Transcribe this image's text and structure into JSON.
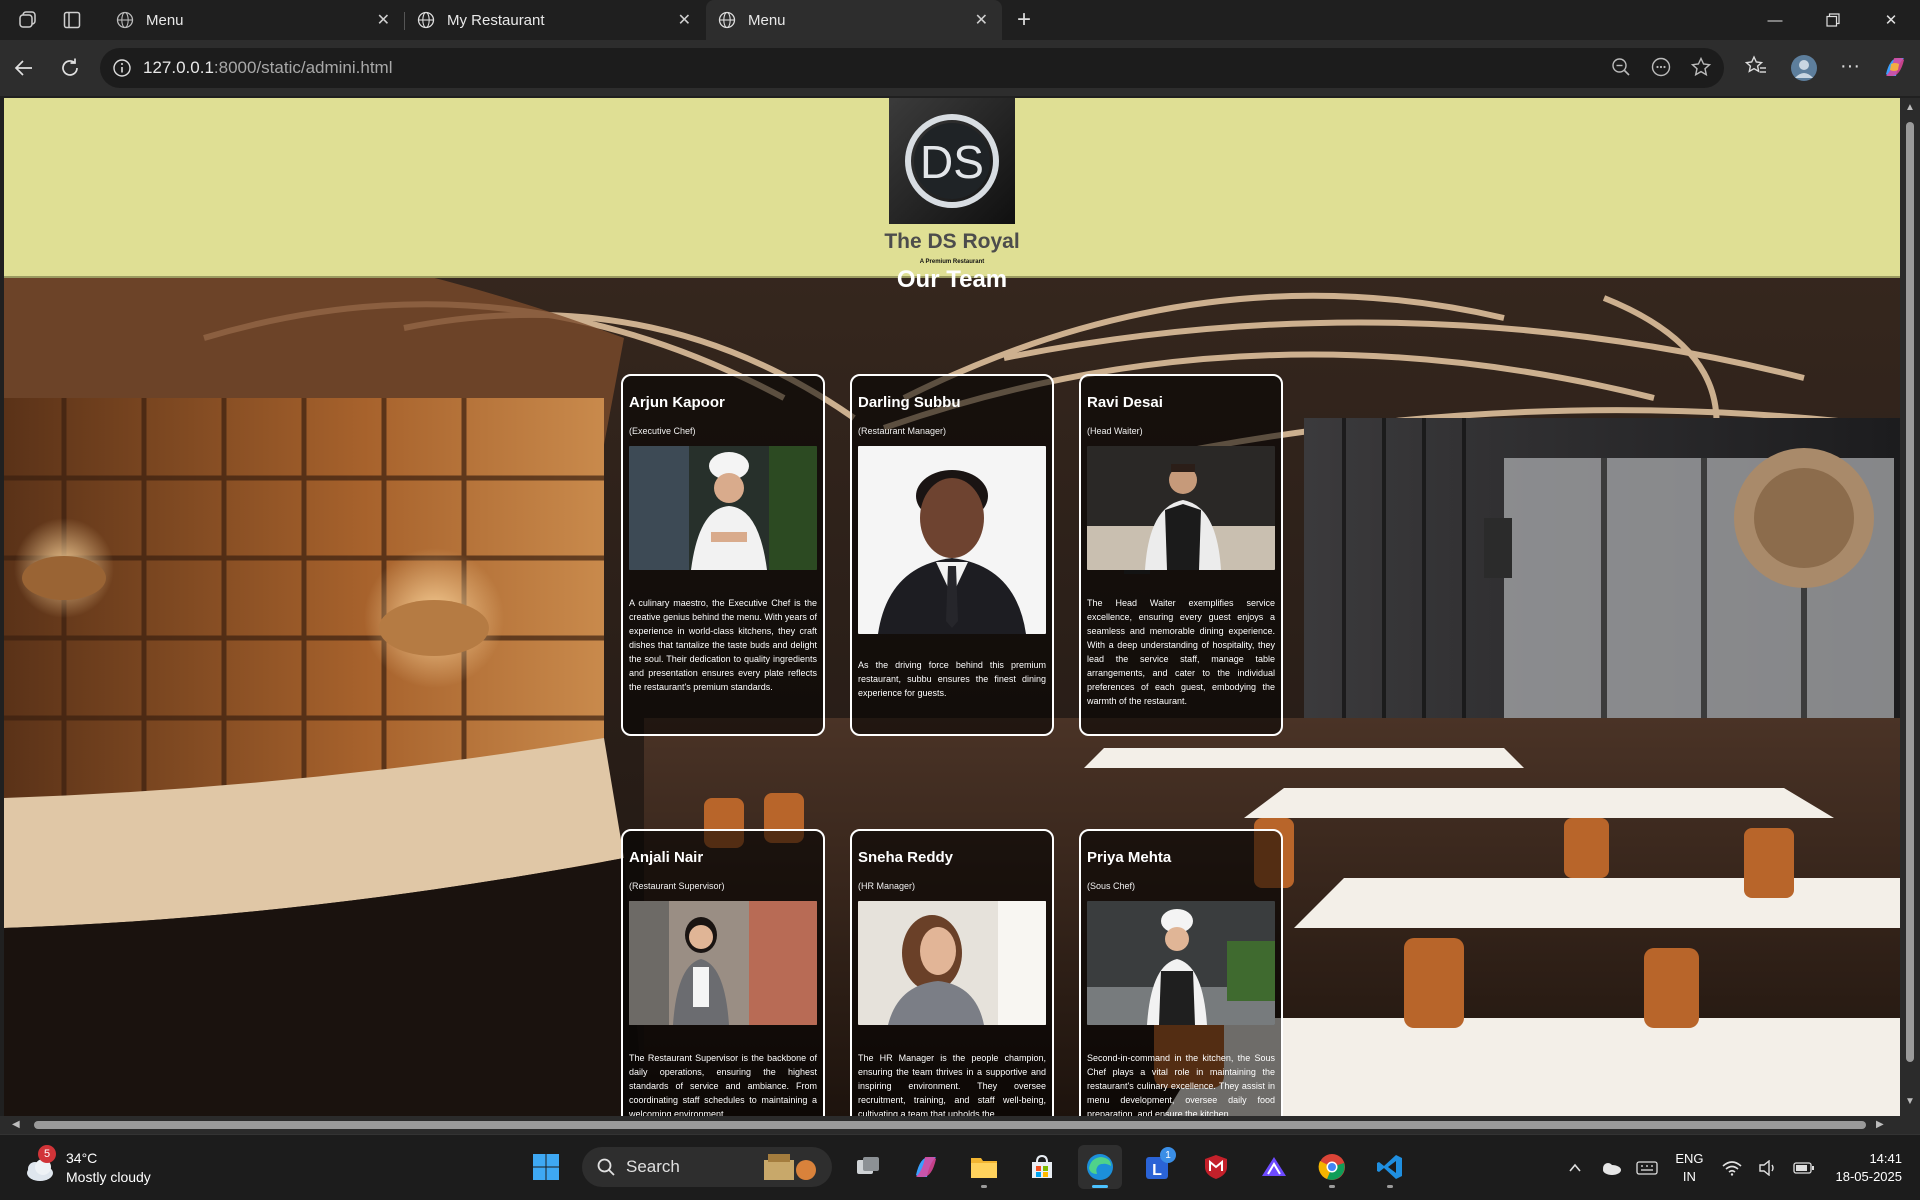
{
  "browser": {
    "tabs": [
      {
        "title": "Menu",
        "active": false
      },
      {
        "title": "My Restaurant",
        "active": false
      },
      {
        "title": "Menu",
        "active": true
      }
    ],
    "url_host": "127.0.0.1",
    "url_rest": ":8000/static/admini.html"
  },
  "site": {
    "logo_text": "DS",
    "brand_name": "The DS Royal",
    "brand_tagline": "A Premium Restaurant",
    "section_title": "Our Team"
  },
  "team": [
    {
      "name": "Arjun Kapoor",
      "role": "(Executive Chef)",
      "photo_icon": "chef-photo",
      "desc": "A culinary maestro, the Executive Chef is the creative genius behind the menu. With years of experience in world-class kitchens, they craft dishes that tantalize the taste buds and delight the soul. Their dedication to quality ingredients and presentation ensures every plate reflects the restaurant's premium standards."
    },
    {
      "name": "Darling Subbu",
      "role": "(Restaurant Manager)",
      "photo_icon": "manager-photo",
      "desc": "As the driving force behind this premium restaurant, subbu ensures the finest dining experience for guests."
    },
    {
      "name": "Ravi Desai",
      "role": "(Head Waiter)",
      "photo_icon": "waiter-photo",
      "desc": "The Head Waiter exemplifies service excellence, ensuring every guest enjoys a seamless and memorable dining experience. With a deep understanding of hospitality, they lead the service staff, manage table arrangements, and cater to the individual preferences of each guest, embodying the warmth of the restaurant."
    },
    {
      "name": "Anjali Nair",
      "role": "(Restaurant Supervisor)",
      "photo_icon": "supervisor-photo",
      "desc": "The Restaurant Supervisor is the backbone of daily operations, ensuring the highest standards of service and ambiance. From coordinating staff schedules to maintaining a welcoming environment,"
    },
    {
      "name": "Sneha Reddy",
      "role": "(HR Manager)",
      "photo_icon": "hr-photo",
      "desc": "The HR Manager is the people champion, ensuring the team thrives in a supportive and inspiring environment. They oversee recruitment, training, and staff well-being, cultivating a team that upholds the"
    },
    {
      "name": "Priya Mehta",
      "role": "(Sous Chef)",
      "photo_icon": "sous-chef-photo",
      "desc": "Second-in-command in the kitchen, the Sous Chef plays a vital role in maintaining the restaurant's culinary excellence. They assist in menu development, oversee daily food preparation, and ensure the kitchen"
    }
  ],
  "taskbar": {
    "weather_badge": "5",
    "temperature": "34°C",
    "condition": "Mostly cloudy",
    "search_label": "Search",
    "mail_badge": "1",
    "lang_top": "ENG",
    "lang_bottom": "IN",
    "time": "14:41",
    "date": "18-05-2025"
  },
  "colors": {
    "header_bg": "#dfdf94",
    "brand_text": "#4c4c4c",
    "card_border": "#ffffff",
    "accent": "#4cc2ff"
  }
}
